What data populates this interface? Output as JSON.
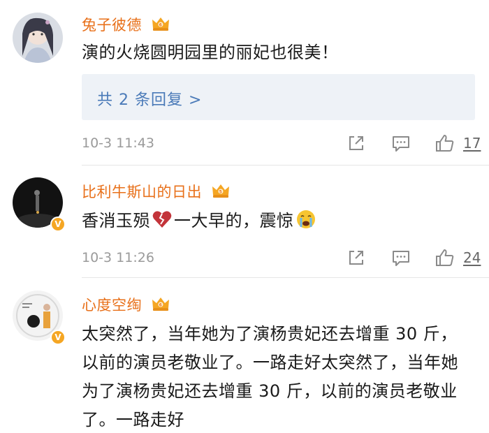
{
  "comments": [
    {
      "username": "兔子彼德",
      "text": "演的火烧圆明园里的丽妃也很美！",
      "replies_label": "共 2 条回复 >",
      "timestamp": "10-3  11:43",
      "like_count": "17"
    },
    {
      "username": "比利牛斯山的日出",
      "text_part1": "香消玉殒",
      "text_part2": "一大早的，震惊",
      "timestamp": "10-3  11:26",
      "like_count": "24"
    },
    {
      "username": "心度空绹",
      "text": "太突然了，当年她为了演杨贵妃还去增重 30 斤，以前的演员老敬业了。一路走好太突然了，当年她为了演杨贵妃还去增重 30 斤，以前的演员老敬业了。一路走好"
    }
  ],
  "colors": {
    "username": "#e8701a",
    "replies_text": "#4a7ab8",
    "replies_bg": "#eef2f7",
    "timestamp": "#9a9a9a",
    "vip_badge": "#f5a623"
  },
  "icons": {
    "share": "share-icon",
    "comment": "comment-icon",
    "like": "thumbs-up-icon",
    "member": "crown-icon",
    "verified": "verified-v-icon"
  }
}
